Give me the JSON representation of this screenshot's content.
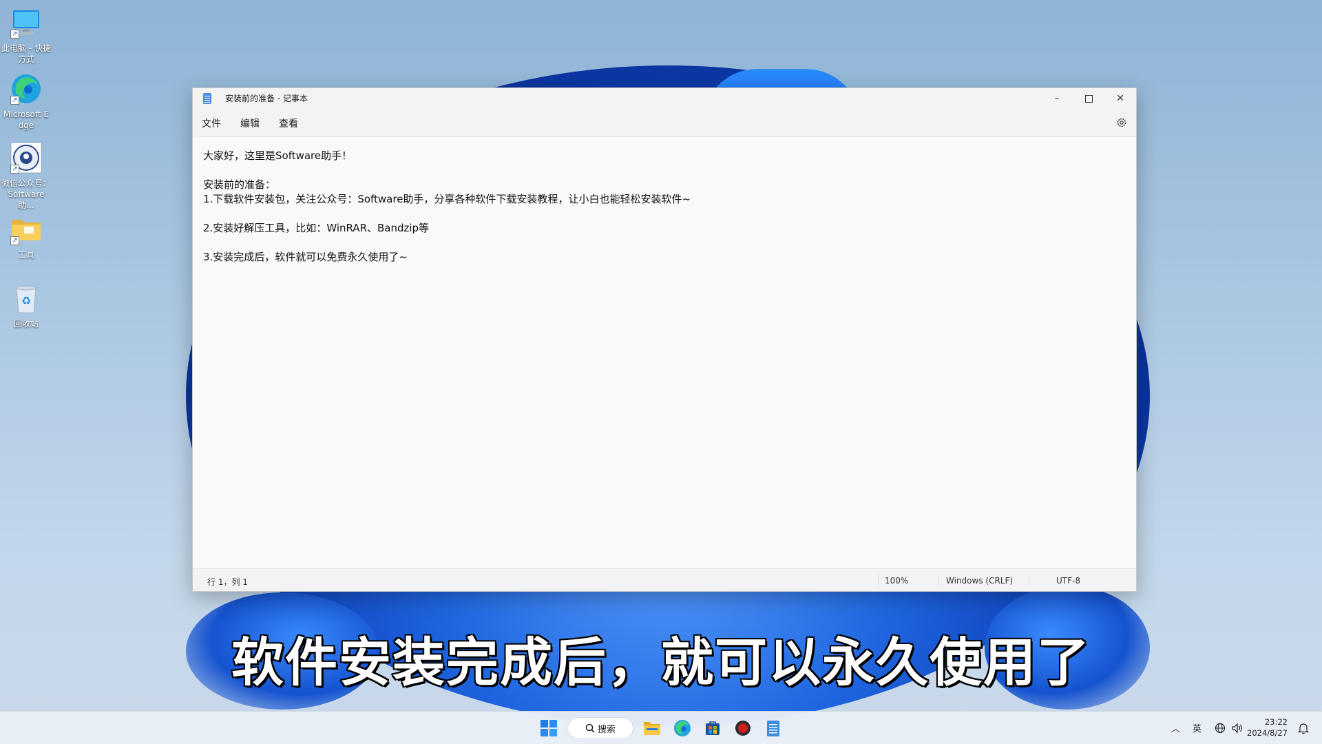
{
  "desktop": {
    "icons": [
      {
        "label": "此电脑 - 快捷方式"
      },
      {
        "label": "Microsoft Edge"
      },
      {
        "label": "微信公众号：Software助..."
      },
      {
        "label": "工具"
      },
      {
        "label": "回收站"
      }
    ]
  },
  "window": {
    "title": "安装前的准备 - 记事本",
    "menu": [
      "文件",
      "编辑",
      "查看"
    ],
    "content_lines": [
      "大家好，这里是Software助手！",
      "",
      "安装前的准备：",
      "1.下载软件安装包，关注公众号：Software助手，分享各种软件下载安装教程，让小白也能轻松安装软件~",
      "",
      "2.安装好解压工具，比如：WinRAR、Bandzip等",
      "",
      "3.安装完成后，软件就可以免费永久使用了~"
    ],
    "status": {
      "position": "行 1，列 1",
      "zoom": "100%",
      "line_ending": "Windows (CRLF)",
      "encoding": "UTF-8"
    }
  },
  "subtitle": "软件安装完成后，就可以永久使用了",
  "taskbar": {
    "search_label": "搜索",
    "ime": "英",
    "time": "23:22",
    "date": "2024/8/27"
  },
  "colors": {
    "accent": "#0067c0",
    "bloom": "#1f66e0",
    "record": "#d11d1d"
  }
}
